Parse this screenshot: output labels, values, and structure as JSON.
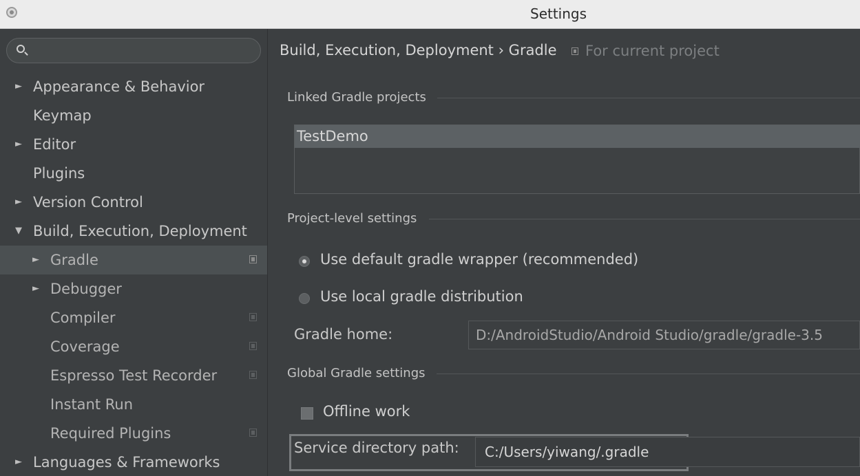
{
  "window": {
    "title": "Settings"
  },
  "search": {
    "placeholder": ""
  },
  "sidebar": {
    "items": [
      {
        "label": "Appearance & Behavior",
        "arrow": "►"
      },
      {
        "label": "Keymap"
      },
      {
        "label": "Editor",
        "arrow": "►"
      },
      {
        "label": "Plugins"
      },
      {
        "label": "Version Control",
        "arrow": "►"
      },
      {
        "label": "Build, Execution, Deployment",
        "arrow": "▼"
      },
      {
        "label": "Gradle",
        "arrow": "►",
        "selected": true
      },
      {
        "label": "Debugger",
        "arrow": "►"
      },
      {
        "label": "Compiler"
      },
      {
        "label": "Coverage"
      },
      {
        "label": "Espresso Test Recorder"
      },
      {
        "label": "Instant Run"
      },
      {
        "label": "Required Plugins"
      },
      {
        "label": "Languages & Frameworks",
        "arrow": "►"
      }
    ]
  },
  "content": {
    "breadcrumb": "Build, Execution, Deployment › Gradle",
    "scope": "For current project",
    "linked_title": "Linked Gradle projects",
    "linked_projects": [
      "TestDemo"
    ],
    "project_level_title": "Project-level settings",
    "radio_default": "Use default gradle wrapper (recommended)",
    "radio_local": "Use local gradle distribution",
    "gradle_home_label": "Gradle home:",
    "gradle_home_value": "D:/AndroidStudio/Android Studio/gradle/gradle-3.5",
    "global_title": "Global Gradle settings",
    "offline_label": "Offline work",
    "service_label": "Service directory path:",
    "service_value": "C:/Users/yiwang/.gradle"
  },
  "colors": {
    "background": "#3c3f41",
    "selection": "#4b5052",
    "titlebar": "#ececec"
  }
}
